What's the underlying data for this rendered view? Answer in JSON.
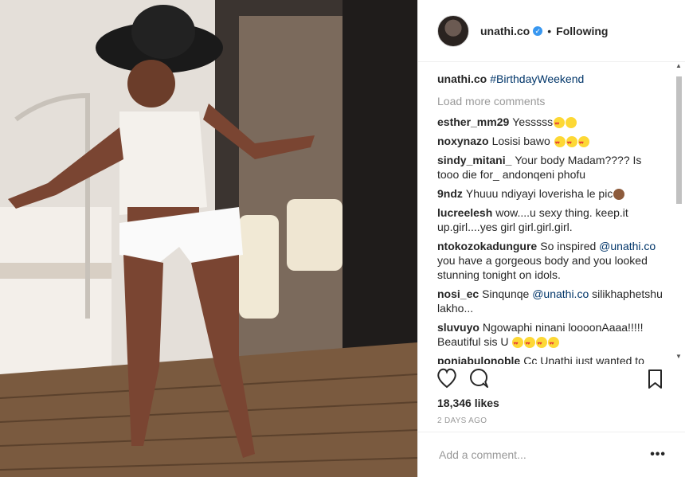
{
  "post": {
    "username": "unathi.co",
    "verified": "✓",
    "separator": "•",
    "follow_status": "Following"
  },
  "caption": {
    "username": "unathi.co",
    "hashtag": "#BirthdayWeekend"
  },
  "load_more": "Load more comments",
  "comments": [
    {
      "user": "esther_mm29",
      "text": "Yesssss"
    },
    {
      "user": "noxynazo",
      "text": "Losisi bawo"
    },
    {
      "user": "sindy_mitani_",
      "text": "Your body Madam???? Is tooo die for_ andonqeni phofu"
    },
    {
      "user": "9ndz",
      "text": "Yhuuu ndiyayi loverisha le pic"
    },
    {
      "user": "lucreelesh",
      "text": "wow....u sexy thing. keep.it up.girl....yes girl girl.girl.girl."
    },
    {
      "user": "ntokozokadungure",
      "text": "So inspired ",
      "mention": "@unathi.co",
      "text2": " you have a gorgeous body and you looked stunning tonight on idols."
    },
    {
      "user": "nosi_ec",
      "text": "Sinqunqe ",
      "mention": "@unathi.co",
      "text2": " silikhaphetshu lakho..."
    },
    {
      "user": "sluvuyo",
      "text": "Ngowaphi ninani loooonAaaa!!!!! Beautiful sis U"
    },
    {
      "user": "ponjabulonoble",
      "text": "Cc Unathi just wanted to"
    }
  ],
  "likes": "18,346 likes",
  "date": "2 DAYS AGO",
  "add_comment_placeholder": "Add a comment...",
  "more_label": "•••",
  "icons": {
    "like": "heart-icon",
    "comment": "comment-icon",
    "save": "bookmark-icon"
  },
  "colors": {
    "link": "#003569",
    "verified": "#3897f0",
    "muted": "#999999"
  }
}
